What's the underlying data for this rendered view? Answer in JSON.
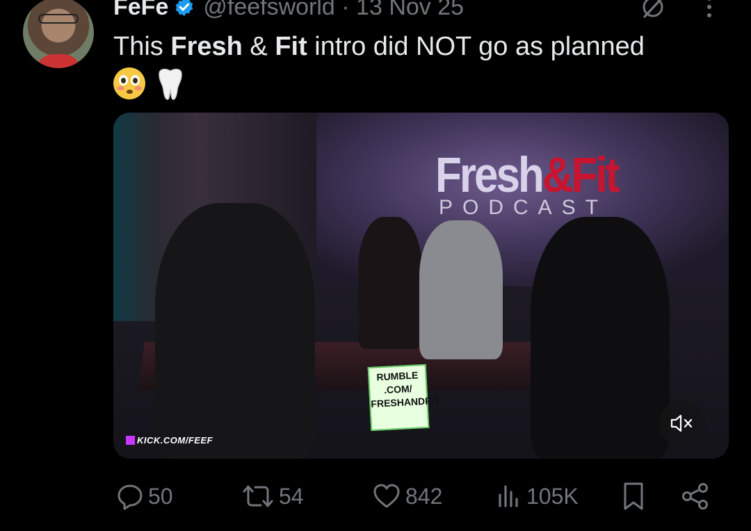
{
  "tweet": {
    "author_name": "FeFe",
    "handle_date": "@feefsworld · 13 Nov 25",
    "text": {
      "part1": "This ",
      "bold1": "Fresh",
      "part2": " & ",
      "bold2": "Fit",
      "part3": " intro did NOT go as planned"
    },
    "emojis": [
      "flushed-face",
      "tooth"
    ]
  },
  "media": {
    "studio_logo_main": "Fresh",
    "studio_logo_amp": "&",
    "studio_logo_fit": "Fit",
    "studio_logo_sub": "PODCAST",
    "sign_lines": [
      "RUMBLE",
      ".COM/",
      "FRESHANDFIT"
    ],
    "watermark": "KICK.COM/FEEF",
    "mute_icon": "speaker-muted-icon"
  },
  "actions": {
    "replies": "50",
    "reposts": "54",
    "likes": "842",
    "views": "105K"
  },
  "colors": {
    "background": "#000000",
    "text_primary": "#e7e9ea",
    "text_secondary": "#71767b",
    "verified": "#1d9bf0"
  }
}
